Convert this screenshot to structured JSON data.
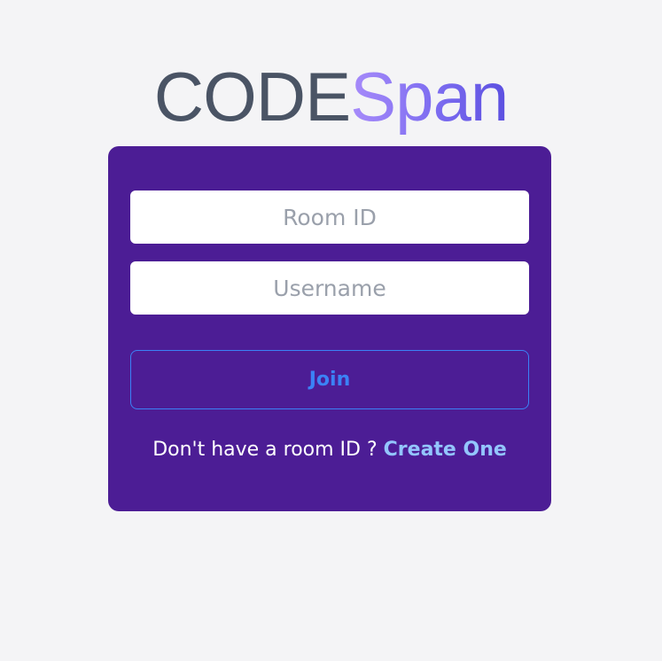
{
  "logo": {
    "main": "CODE",
    "accent": "Span"
  },
  "form": {
    "room_id_placeholder": "Room ID",
    "username_placeholder": "Username",
    "join_label": "Join",
    "prompt_text": "Don't have a room ID ? ",
    "create_link_label": "Create One"
  },
  "colors": {
    "page_background": "#f4f4f6",
    "card_background": "#4c1d95",
    "logo_main": "#4a5465",
    "logo_accent_start": "#a78bfa",
    "logo_accent_end": "#5b4fe0",
    "join_button": "#3b82f6",
    "create_link": "#93c5fd"
  }
}
